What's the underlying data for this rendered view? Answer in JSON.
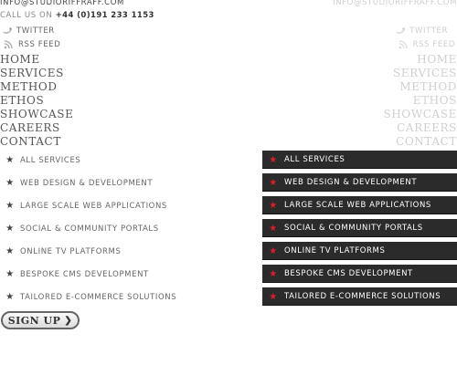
{
  "contact": {
    "email": "INFO@STUDIORIFFRAFF.COM",
    "call_label": "CALL US ON",
    "phone": "+44 (0)191 233 1153"
  },
  "social": {
    "twitter": "TWITTER",
    "rss": "RSS FEED"
  },
  "nav": [
    "HOME",
    "SERVICES",
    "METHOD",
    "ETHOS",
    "SHOWCASE",
    "CAREERS",
    "CONTACT"
  ],
  "services": [
    "ALL SERVICES",
    "WEB DESIGN & DEVELOPMENT",
    "LARGE SCALE WEB APPLICATIONS",
    "SOCIAL & COMMUNITY  PORTALS",
    "ONLINE TV PLATFORMS",
    "BESPOKE CMS DEVELOPMENT",
    "TAILORED E-COMMERCE SOLUTIONS"
  ],
  "signup_label": "SIGN UP",
  "icons": {
    "twitter": "twitter-bird-icon",
    "rss": "rss-icon",
    "bullet": "star-icon",
    "signup": "chevron-right-icon"
  },
  "colors": {
    "active_bg": "#2b2b2b",
    "star_active": "#d8202a",
    "muted": "#cfcfcf"
  }
}
